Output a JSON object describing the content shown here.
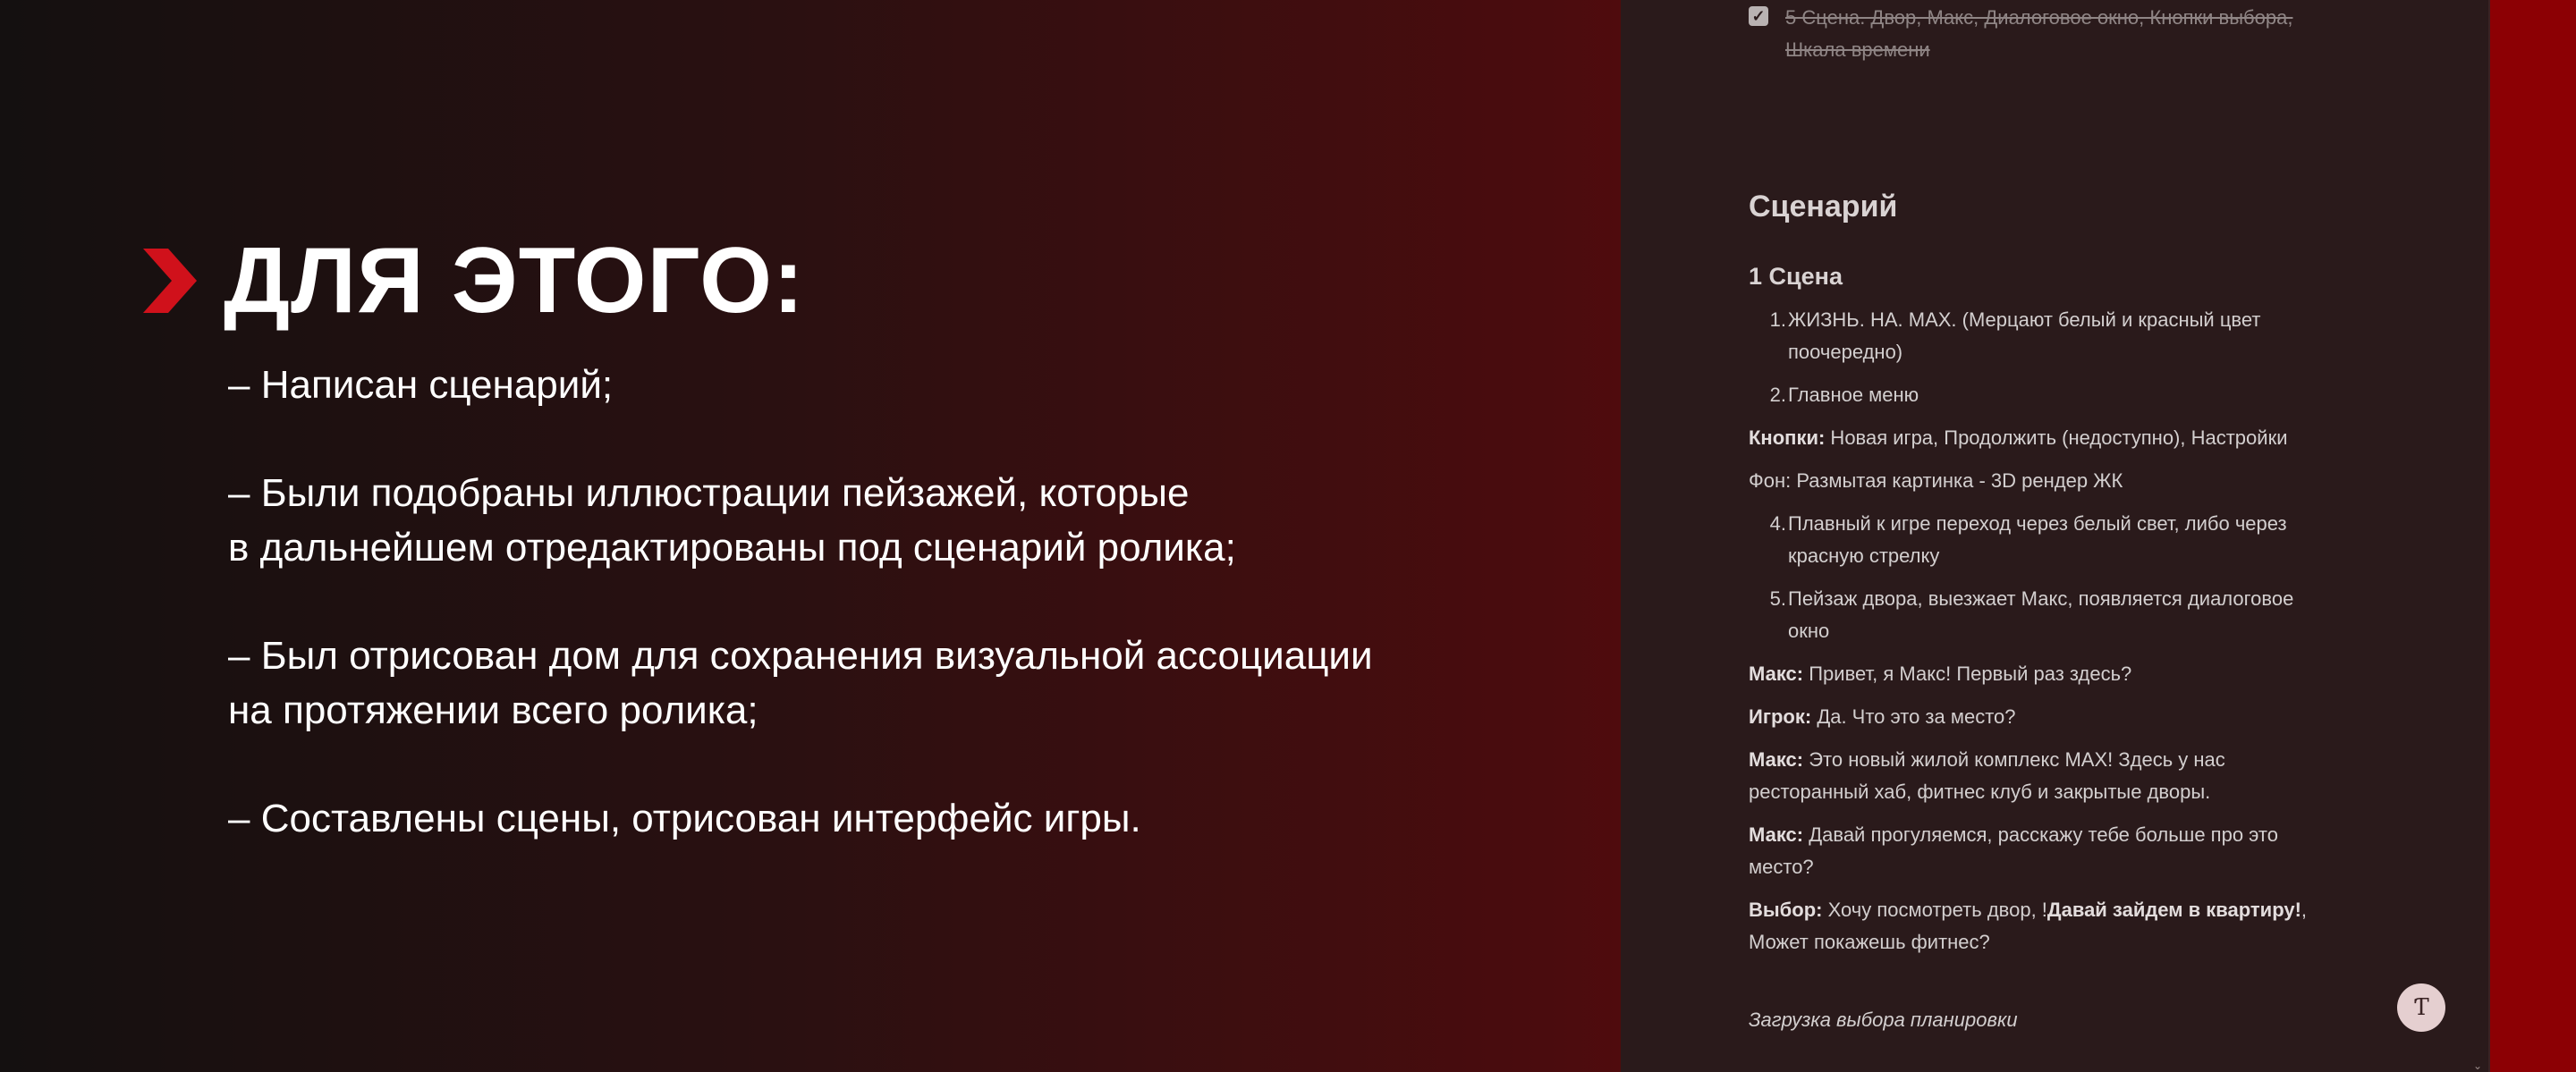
{
  "slide": {
    "title": "ДЛЯ ЭТОГО:",
    "bullets": [
      "– Написан сценарий;",
      "– Были подобраны иллюстрации пейзажей, которые\nв дальнейшем отредактированы под сценарий ролика;",
      "– Был отрисован дом для сохранения визуальной ассоциации\nна протяжении всего ролика;",
      "– Составлены сцены, отрисован интерфейс игры."
    ],
    "accent_color": "#d0111b"
  },
  "notes": {
    "done_item": "5 Сцена. Двор, Макс, Диалоговое окно, Кнопки выбора, Шкала времени",
    "section_title": "Сценарий",
    "scene_title": "1 Сцена",
    "list_1": [
      {
        "num": "1.",
        "text": "ЖИЗНЬ. НА. MAX. (Мерцают белый и красный цвет поочередно)"
      },
      {
        "num": "2.",
        "text": "Главное меню"
      }
    ],
    "buttons_label": "Кнопки:",
    "buttons_text": " Новая игра, Продолжить (недоступно), Настройки",
    "bg_text": "Фон: Размытая картинка - 3D рендер ЖК",
    "list_2": [
      {
        "num": "4.",
        "text": "Плавный к игре переход через белый свет, либо через красную стрелку"
      },
      {
        "num": "5.",
        "text": "Пейзаж двора, выезжает Макс, появляется диалоговое окно"
      }
    ],
    "dialog": [
      {
        "speaker": "Макс:",
        "text": " Привет, я Макс! Первый раз здесь?"
      },
      {
        "speaker": "Игрок:",
        "text": " Да. Что это за место?"
      },
      {
        "speaker": "Макс:",
        "text": " Это новый жилой комплекс MAX! Здесь у нас ресторанный хаб, фитнес клуб и закрытые дворы."
      },
      {
        "speaker": "Макс:",
        "text": " Давай прогуляемся, расскажу тебе больше про это место?"
      }
    ],
    "choice_label": "Выбор:",
    "choice_text_1": " Хочу посмотреть двор, !",
    "choice_bold": "Давай зайдем в квартиру!",
    "choice_text_2": ", Может покажешь фитнес?",
    "italic_note": "Загрузка выбора планировки",
    "avatar_glyph": "Ƭ"
  }
}
